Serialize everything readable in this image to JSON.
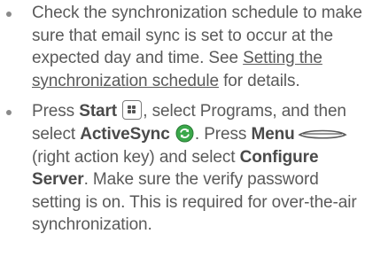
{
  "bullets": [
    {
      "text_a": "Check the synchronization schedule to make sure that email sync is set to occur at the expected day and time. See ",
      "link": "Setting the synchronization schedule",
      "text_b": " for details."
    },
    {
      "t1": "Press ",
      "b1": "Start",
      "t2": ", select Programs, and then select ",
      "b2": "ActiveSync",
      "t3": ". Press ",
      "b3": "Menu",
      "t4": " (right action key) and select ",
      "b4": "Configure Server",
      "t5": ". Make sure the verify password setting is on. This is required for over-the-air synchronization."
    }
  ],
  "icons": {
    "start": "windows-start-key-icon",
    "activesync": "activesync-icon",
    "menu": "right-action-key-icon"
  },
  "colors": {
    "text": "#5a5a5a",
    "bullet": "#8a8a8a",
    "activesync_green": "#3aa84a"
  }
}
